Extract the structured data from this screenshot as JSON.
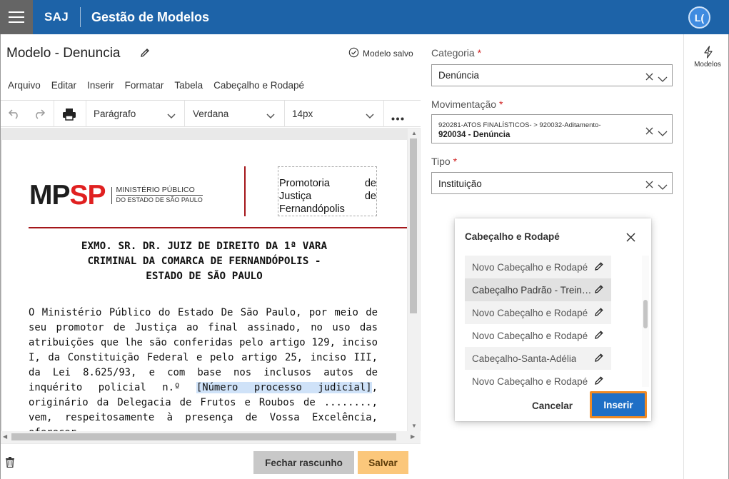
{
  "topbar": {
    "brand": "SAJ",
    "app_title": "Gestão de Modelos",
    "avatar_initials": "L("
  },
  "editor": {
    "title": "Modelo - Denuncia",
    "saved_status": "Modelo salvo",
    "menu": [
      "Arquivo",
      "Editar",
      "Inserir",
      "Formatar",
      "Tabela",
      "Cabeçalho e Rodapé"
    ],
    "toolbar": {
      "paragraph": "Parágrafo",
      "font": "Verdana",
      "size": "14px"
    }
  },
  "document": {
    "logo_mp": "MP",
    "logo_sp": "SP",
    "logo_org_line1": "MINISTÉRIO PÚBLICO",
    "logo_org_line2": "DO ESTADO DE SÃO PAULO",
    "promo_line1_a": "Promotoria",
    "promo_line1_b": "de",
    "promo_line2_a": "Justiça",
    "promo_line2_b": "de",
    "promo_line3": "Fernandópolis",
    "heading_line1": "EXMO. SR. DR. JUIZ DE DIREITO DA 1ª VARA",
    "heading_line2": "CRIMINAL DA COMARCA DE FERNANDÓPOLIS -",
    "heading_line3": "ESTADO DE SÃO PAULO",
    "body_before": "O Ministério Público do Estado De São Paulo, por meio de seu promotor de Justiça ao final assinado, no uso das atribuições que lhe são conferidas pelo artigo 129, inciso I, da Constituição Federal e pelo artigo 25, inciso III, da Lei 8.625/93, e com base nos inclusos autos de inquérito policial n.º ",
    "body_highlight": "[Número processo judicial]",
    "body_after": ", originário da Delegacia de Frutos e Roubos de ........, vem, respeitosamente à presença de Vossa Excelência, oferecer"
  },
  "footer": {
    "close_draft": "Fechar rascunho",
    "save": "Salvar"
  },
  "form": {
    "categoria_label": "Categoria",
    "categoria_value": "Denúncia",
    "movimentacao_label": "Movimentação",
    "movimentacao_path": "920281-ATOS FINALÍSTICOS- > 920032-Aditamento-",
    "movimentacao_value": "920034 - Denúncia",
    "tipo_label": "Tipo",
    "tipo_value": "Instituição",
    "required_mark": "*"
  },
  "rail": {
    "models_label": "Modelos"
  },
  "dialog": {
    "title": "Cabeçalho e Rodapé",
    "items": [
      "Novo Cabeçalho e Rodapé",
      "Cabeçalho Padrão - Treinamento",
      "Novo Cabeçalho e Rodapé",
      "Novo Cabeçalho e Rodapé",
      "Cabeçalho-Santa-Adélia",
      "Novo Cabeçalho e Rodapé"
    ],
    "cancel": "Cancelar",
    "insert": "Inserir"
  }
}
